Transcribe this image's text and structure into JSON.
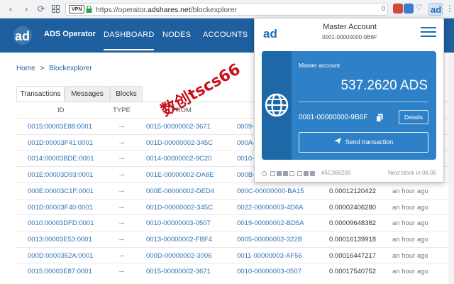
{
  "browser": {
    "vpn_label": "VPN",
    "url_prefix": "https://operator.",
    "url_host": "adshares.net",
    "url_path": "/blockexplorer",
    "ext_count": "0"
  },
  "app": {
    "name": "ADS Operator",
    "nav": [
      "DASHBOARD",
      "NODES",
      "ACCOUNTS"
    ],
    "accent": "#1d5f9f"
  },
  "breadcrumb": {
    "home": "Home",
    "separator": ">",
    "current": "Blockexplorer"
  },
  "tabs": [
    "Transactions",
    "Messages",
    "Blocks"
  ],
  "table": {
    "headers": [
      "ID",
      "TYPE",
      "FROM"
    ],
    "type_icon": "→",
    "rows": [
      {
        "id": "0015:00003E88:0001",
        "from": "0015-00000002-3671",
        "to": "0009-",
        "amount": "",
        "time": ""
      },
      {
        "id": "001D:00003F41:0001",
        "from": "001D-00000002-345C",
        "to": "000A-",
        "amount": "",
        "time": ""
      },
      {
        "id": "0014:00003BDE:0001",
        "from": "0014-00000002-9C20",
        "to": "0010-",
        "amount": "",
        "time": ""
      },
      {
        "id": "001E:00003D93:0001",
        "from": "001E-00000002-DA8E",
        "to": "000B-",
        "amount": "",
        "time": ""
      },
      {
        "id": "000E:00003C1F:0001",
        "from": "000E-00000002-DED4",
        "to": "000C-00000000-BA15",
        "amount": "0.00012120422",
        "time": "an hour ago"
      },
      {
        "id": "001D:00003F40:0001",
        "from": "001D-00000002-345C",
        "to": "0022-00000003-4D6A",
        "amount": "0.00002406280",
        "time": "an hour ago"
      },
      {
        "id": "0010:00003DFD:0001",
        "from": "0010-00000003-0507",
        "to": "0019-00000002-BD5A",
        "amount": "0.00009648382",
        "time": "an hour ago"
      },
      {
        "id": "0013:00003E53:0001",
        "from": "0013-00000002-FBF4",
        "to": "0005-00000002-322B",
        "amount": "0.00016139918",
        "time": "an hour ago"
      },
      {
        "id": "000D:0000352A:0001",
        "from": "000D-00000002-3006",
        "to": "0011-00000003-AF56",
        "amount": "0.00016447217",
        "time": "an hour ago"
      },
      {
        "id": "0015:00003E87:0001",
        "from": "0015-00000002-3671",
        "to": "0010-00000003-0507",
        "amount": "0.00017540752",
        "time": "an hour ago"
      }
    ]
  },
  "popup": {
    "title": "Master Account",
    "address": "0001-00000000-9B6F",
    "card": {
      "label": "Master account",
      "balance": "537.2620 ADS",
      "account": "0001-00000000-9B6F",
      "details_label": "Details",
      "send_label": "Send transaction"
    },
    "status": {
      "hash": "#5C366200",
      "next_block": "Next block in 06:06"
    }
  },
  "watermark": "数创tscs66"
}
